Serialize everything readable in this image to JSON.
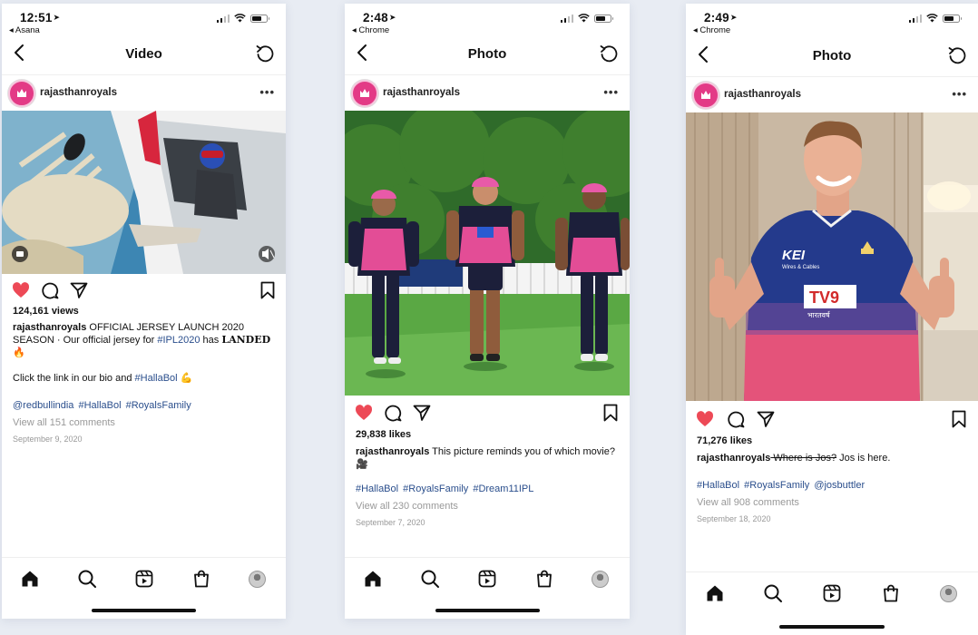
{
  "phones": [
    {
      "status": {
        "time": "12:51",
        "back_app": "◂ Asana"
      },
      "nav": {
        "title": "Video"
      },
      "post": {
        "username": "rajasthanroyals",
        "views": "124,161 views",
        "caption_user": "rajasthanroyals",
        "caption_1": " OFFICIAL JERSEY LAUNCH  2020 SEASON · Our official jersey for ",
        "caption_tag": "#IPL2020",
        "caption_2": " has ",
        "caption_bold": "𝐋𝐀𝐍𝐃𝐄𝐃",
        "caption_emoji": "🔥",
        "caption_line2": "Click the link in our bio and ",
        "caption_line2_tag": "#HallaBol",
        "caption_line2_emoji": "💪",
        "tags": "@redbullindia  #HallaBol  #RoyalsFamily",
        "comments": "View all 151 comments",
        "date": "September 9, 2020"
      }
    },
    {
      "status": {
        "time": "2:48",
        "back_app": "◂ Chrome"
      },
      "nav": {
        "title": "Photo"
      },
      "post": {
        "username": "rajasthanroyals",
        "likes": "29,838 likes",
        "caption_user": "rajasthanroyals",
        "caption": " This picture reminds you of which movie? 🎥",
        "tags": "#HallaBol  #RoyalsFamily  #Dream11IPL",
        "comments": "View all 230 comments",
        "date": "September 7, 2020"
      }
    },
    {
      "status": {
        "time": "2:49",
        "back_app": "◂ Chrome"
      },
      "nav": {
        "title": "Photo"
      },
      "post": {
        "username": "rajasthanroyals",
        "likes": "71,276 likes",
        "caption_user": "rajasthanroyals",
        "caption_strike": " Where is Jos?",
        "caption": " Jos is here.",
        "tags": "#HallaBol  #RoyalsFamily  @josbuttler",
        "comments": "View all 908 comments",
        "date": "September 18, 2020"
      }
    }
  ],
  "jersey": {
    "sponsor_main": "KEI",
    "sponsor_sub": "Wires & Cables",
    "tv_logo": "TV9",
    "tv_sub": "भारतवर्ष"
  },
  "colors": {
    "like_red": "#ed4956",
    "tag_blue": "#2a4e8c",
    "royals_pink": "#e33a86",
    "jersey_navy": "#243a8c"
  },
  "icons": [
    "heart-icon",
    "comment-icon",
    "share-icon",
    "bookmark-icon",
    "home-icon",
    "search-icon",
    "reels-icon",
    "shop-icon",
    "back-chevron-icon",
    "refresh-icon",
    "more-icon",
    "mute-icon"
  ]
}
